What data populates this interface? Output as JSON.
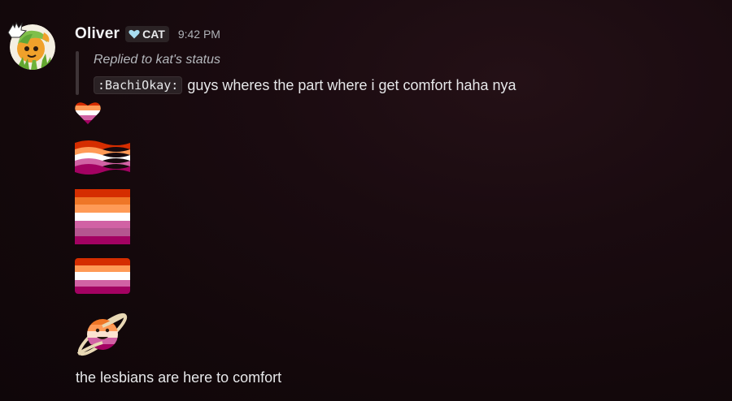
{
  "author": {
    "name": "Oliver",
    "tag_label": "CAT",
    "timestamp": "9:42 PM"
  },
  "reply": {
    "text": "Replied to kat's status",
    "emoji_code": ":BachiOkay:",
    "quote": "guys wheres the part where i get comfort haha nya"
  },
  "emojis": [
    "lesbian-heart-emoji",
    "lesbian-wavy-flag-emoji",
    "lesbian-seven-stripe-flag-emoji",
    "lesbian-five-stripe-flag-emoji",
    "lesbian-planet-emoji"
  ],
  "message_text": "the lesbians are here to comfort",
  "colors": {
    "stripe_dark_orange": "#d52d00",
    "stripe_orange": "#ef7627",
    "stripe_light_orange": "#ff9a56",
    "stripe_white": "#ffffff",
    "stripe_pink": "#d162a4",
    "stripe_mauve": "#b55690",
    "stripe_magenta": "#a30262",
    "tag_heart": "#a8ddf0"
  }
}
